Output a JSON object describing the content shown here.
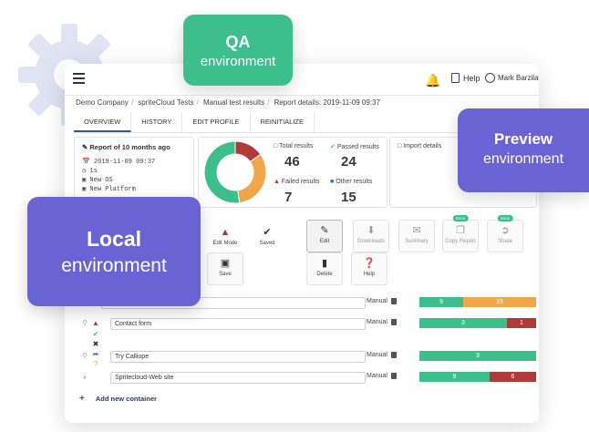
{
  "overlays": {
    "qa": {
      "line1": "QA",
      "line2": "environment",
      "color": "#3dbf8d"
    },
    "preview": {
      "line1": "Preview",
      "line2": "environment",
      "color": "#6a63d4"
    },
    "local": {
      "line1": "Local",
      "line2": "environment",
      "color": "#6a63d4"
    }
  },
  "header": {
    "help_label": "Help",
    "user_name": "Mark Barzilay"
  },
  "breadcrumb": {
    "items": [
      "Demo Company",
      "spriteCloud Tests",
      "Manual test results",
      "Report details: 2019-11-09 09:37"
    ]
  },
  "tabs": [
    "OVERVIEW",
    "HISTORY",
    "EDIT PROFILE",
    "REINITIALIZE"
  ],
  "report": {
    "title": "Report of 10 months ago",
    "rows": [
      "2019-11-09 09:37",
      "1s",
      "New OS",
      "New Platform"
    ]
  },
  "stats": {
    "total": {
      "label": "Total results",
      "value": "46"
    },
    "passed": {
      "label": "Passed results",
      "value": "24"
    },
    "failed": {
      "label": "Failed results",
      "value": "7"
    },
    "other": {
      "label": "Other results",
      "value": "15"
    }
  },
  "donut": {
    "passed": 24,
    "other": 15,
    "failed": 7,
    "colors": {
      "passed": "#3dbf8d",
      "other": "#f0a74a",
      "failed": "#b03a3a"
    }
  },
  "import_details": {
    "title": "Import details"
  },
  "toolbar": {
    "edit_mode": "Edit Mode",
    "saved": "Saved",
    "edit": "Edit",
    "downloads": "Downloads",
    "summary": "Summary",
    "copy_report": "Copy Report",
    "share": "Share",
    "save": "Save",
    "delete": "Delete",
    "help": "Help",
    "badge_copy": "Soon",
    "badge_share": "Soon"
  },
  "results": [
    {
      "name": "",
      "mode": "Manual",
      "bar": [
        {
          "v": "9",
          "c": "#3dbf8d",
          "w": 9
        },
        {
          "v": "15",
          "c": "#f0a74a",
          "w": 15
        }
      ]
    },
    {
      "name": "Contact form",
      "mode": "Manual",
      "bar": [
        {
          "v": "3",
          "c": "#3dbf8d",
          "w": 3
        },
        {
          "v": "1",
          "c": "#b03a3a",
          "w": 1
        }
      ]
    },
    {
      "name": "Try Calliope",
      "mode": "Manual",
      "bar": [
        {
          "v": "3",
          "c": "#3dbf8d",
          "w": 3
        }
      ]
    },
    {
      "name": "Spritecloud-Web site",
      "mode": "Manual",
      "bar": [
        {
          "v": "9",
          "c": "#3dbf8d",
          "w": 9
        },
        {
          "v": "6",
          "c": "#b03a3a",
          "w": 6
        }
      ]
    }
  ],
  "add_container": "Add new container"
}
